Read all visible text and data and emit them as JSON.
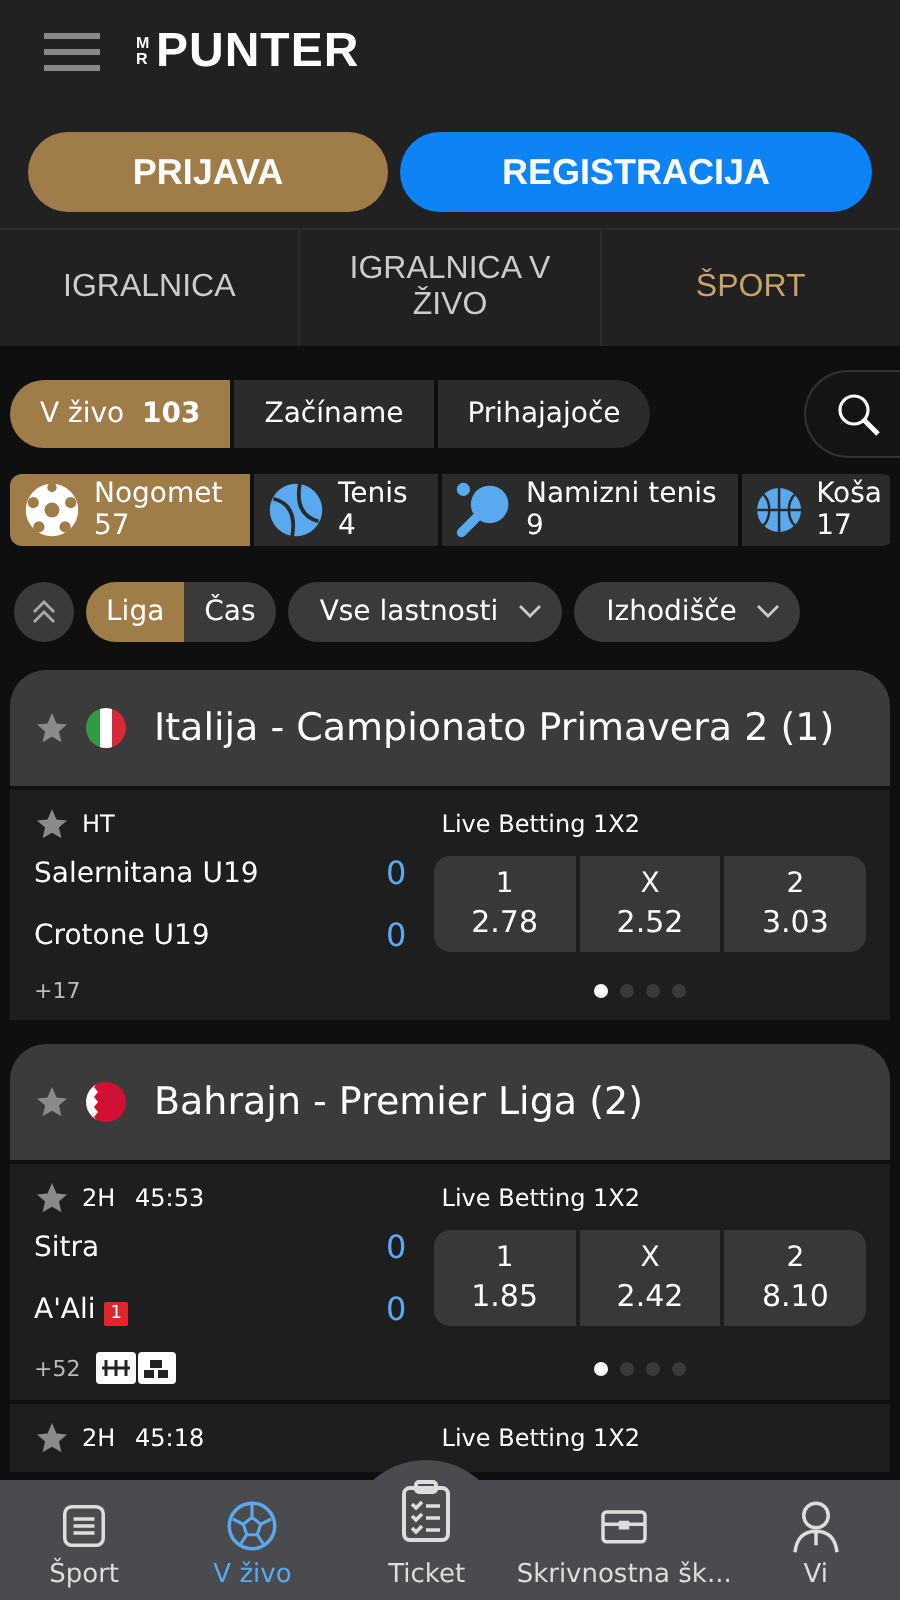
{
  "header": {
    "logo_prefix": "MR",
    "logo": "PUNTER"
  },
  "auth_buttons": [
    {
      "label": "PRIJAVA",
      "kind": "login"
    },
    {
      "label": "REGISTRACIJA",
      "kind": "register"
    }
  ],
  "top_tabs": [
    {
      "label": "IGRALNICA",
      "selected": false
    },
    {
      "label": "IGRALNICA V ŽIVO",
      "selected": false
    },
    {
      "label": "ŠPORT",
      "selected": true
    }
  ],
  "filter_tabs": [
    {
      "label": "V živo",
      "count": "103",
      "selected": true
    },
    {
      "label": "Začíname",
      "selected": false
    },
    {
      "label": "Prihajajoče",
      "selected": false
    }
  ],
  "sports": [
    {
      "name": "Nogomet",
      "count": "57",
      "kind": "soccer",
      "selected": true
    },
    {
      "name": "Tenis",
      "count": "4",
      "kind": "tennis",
      "selected": false
    },
    {
      "name": "Namizni tenis",
      "count": "9",
      "kind": "pingpong",
      "selected": false
    },
    {
      "name": "Koša",
      "count": "17",
      "kind": "basketball",
      "selected": false
    }
  ],
  "sort_toggle": [
    {
      "label": "Liga",
      "selected": true
    },
    {
      "label": "Čas",
      "selected": false
    }
  ],
  "dropdowns": [
    "Vse lastnosti",
    "Izhodišče"
  ],
  "leagues": [
    {
      "title": "Italija - Campionato Primavera 2 (1)",
      "kind": "italy",
      "favorite": false,
      "matches": [
        {
          "favorite": false,
          "period": "HT",
          "market": "Live Betting 1X2",
          "teams": [
            {
              "name": "Salernitana U19",
              "score": "0"
            },
            {
              "name": "Crotone U19",
              "score": "0"
            }
          ],
          "odds": [
            {
              "label": "1",
              "value": "2.78"
            },
            {
              "label": "X",
              "value": "2.52"
            },
            {
              "label": "2",
              "value": "3.03"
            }
          ],
          "more": "+17",
          "stats_icons": false,
          "pages": [
            {
              "selected": true
            },
            {
              "selected": false
            },
            {
              "selected": false
            },
            {
              "selected": false
            }
          ]
        }
      ]
    },
    {
      "title": "Bahrajn - Premier Liga (2)",
      "kind": "bahrain",
      "favorite": false,
      "matches": [
        {
          "favorite": false,
          "period": "2H",
          "clock": "45:53",
          "market": "Live Betting 1X2",
          "teams": [
            {
              "name": "Sitra",
              "score": "0"
            },
            {
              "name": "A'Ali",
              "score": "0",
              "red_cards": "1"
            }
          ],
          "odds": [
            {
              "label": "1",
              "value": "1.85"
            },
            {
              "label": "X",
              "value": "2.42"
            },
            {
              "label": "2",
              "value": "8.10"
            }
          ],
          "more": "+52",
          "stats_icons": true,
          "pages": [
            {
              "selected": true
            },
            {
              "selected": false
            },
            {
              "selected": false
            },
            {
              "selected": false
            }
          ]
        },
        {
          "favorite": false,
          "period": "2H",
          "clock": "45:18",
          "market": "Live Betting 1X2"
        }
      ]
    }
  ],
  "bottom_nav": [
    {
      "label": "Šport",
      "kind": "list",
      "selected": false,
      "raised": false
    },
    {
      "label": "V živo",
      "kind": "ball",
      "selected": true,
      "raised": false
    },
    {
      "label": "Ticket",
      "kind": "clipboard",
      "selected": false,
      "raised": true
    },
    {
      "label": "Skrivnostna šk...",
      "kind": "chest",
      "selected": false,
      "raised": false
    },
    {
      "label": "Vi",
      "kind": "person",
      "selected": false,
      "raised": false
    }
  ]
}
